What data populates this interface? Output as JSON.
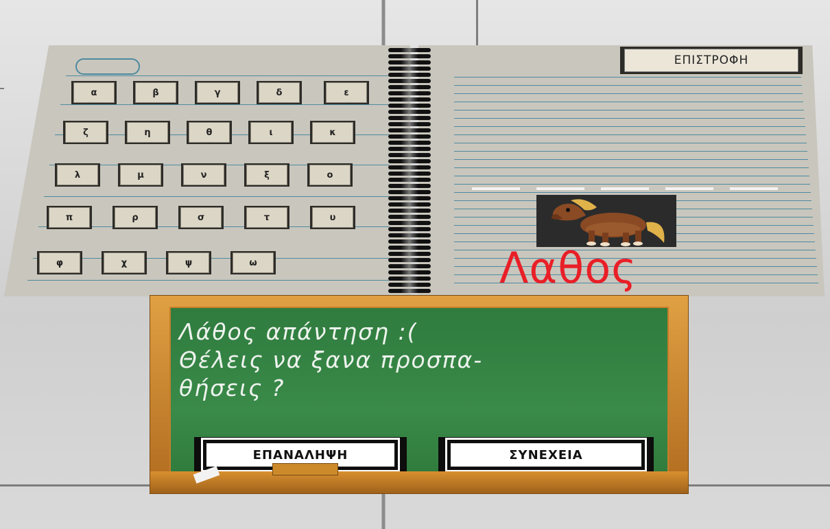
{
  "keyboard": {
    "rows": [
      [
        "α",
        "β",
        "γ",
        "δ",
        "ε"
      ],
      [
        "ζ",
        "η",
        "θ",
        "ι",
        "κ"
      ],
      [
        "λ",
        "μ",
        "ν",
        "ξ",
        "ο"
      ],
      [
        "π",
        "ρ",
        "σ",
        "τ",
        "υ"
      ],
      [
        "φ",
        "χ",
        "ψ",
        "ω"
      ]
    ]
  },
  "header": {
    "return_label": "ΕΠΙΣΤΡΟΦΗ"
  },
  "word": {
    "blank_count": 5,
    "result_word": "Λαθος"
  },
  "dialog": {
    "line1": "Λάθος απάντηση :(",
    "line2": "Θέλεις να ξανα προσπα-",
    "line3": "θήσεις ?",
    "retry_label": "ΕΠΑΝΑΛΗΨΗ",
    "continue_label": "ΣΥΝΕΧΕΙΑ"
  },
  "image": {
    "icon": "pony-icon"
  },
  "colors": {
    "board": "#2f7c3e",
    "wrong": "#e91f27",
    "frame": "#c47e2b"
  }
}
